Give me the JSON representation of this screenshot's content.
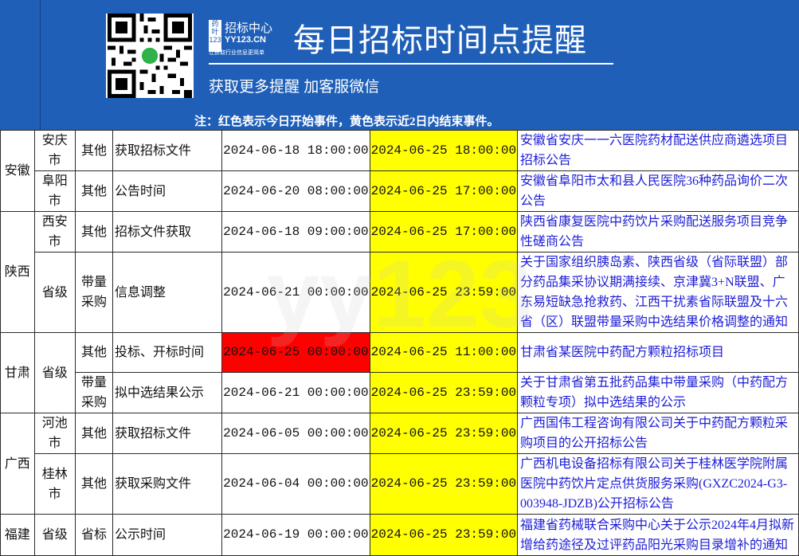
{
  "header": {
    "brand_name": "招标中心",
    "brand_domain": "YY123.CN",
    "brand_badge": "药叶123",
    "brand_slogan": "让获取行业信息更简单",
    "title": "每日招标时间点提醒",
    "subtitle": "获取更多提醒  加客服微信",
    "note": "注：红色表示今日开始事件，黄色表示近2日内结束事件。",
    "colors": {
      "header_bg": "#1f5fb8",
      "start_today": "#ff0000",
      "ending_soon": "#ffff00",
      "link": "#1d1dd6"
    }
  },
  "table": {
    "rows": [
      {
        "province": "安徽",
        "city": "安庆市",
        "type": "其他",
        "event": "获取招标文件",
        "start": "2024-06-18 18:00:00",
        "end": "2024-06-25 18:00:00",
        "project": "安徽省安庆一一六医院药材配送供应商遴选项目招标公告"
      },
      {
        "province": "安徽",
        "city": "阜阳市",
        "type": "其他",
        "event": "公告时间",
        "start": "2024-06-20 08:00:00",
        "end": "2024-06-25 17:00:00",
        "project": "安徽省阜阳市太和县人民医院36种药品询价二次公告"
      },
      {
        "province": "陕西",
        "city": "西安市",
        "type": "其他",
        "event": "招标文件获取",
        "start": "2024-06-18 09:00:00",
        "end": "2024-06-25 17:00:00",
        "project": "陕西省康复医院中药饮片采购配送服务项目竞争性磋商公告"
      },
      {
        "province": "陕西",
        "city": "省级",
        "type": "带量采购",
        "event": "信息调整",
        "start": "2024-06-21 00:00:00",
        "end": "2024-06-25 23:59:00",
        "project": "关于国家组织胰岛素、陕西省级（省际联盟）部分药品集采协议期满接续、京津冀3+N联盟、广东易短缺急抢救药、江西干扰素省际联盟及十六省（区）联盟带量采购中选结果价格调整的通知"
      },
      {
        "province": "甘肃",
        "city": "省级",
        "type": "其他",
        "event": "投标、开标时间",
        "start": "2024-06-25 00:00:00",
        "end": "2024-06-25 11:00:00",
        "project": "甘肃省某医院中药配方颗粒招标项目"
      },
      {
        "province": "甘肃",
        "city": "省级",
        "type": "带量采购",
        "event": "拟中选结果公示",
        "start": "2024-06-21 00:00:00",
        "end": "2024-06-25 23:59:00",
        "project": "关于甘肃省第五批药品集中带量采购（中药配方颗粒专项）拟中选结果的公示"
      },
      {
        "province": "广西",
        "city": "河池市",
        "type": "其他",
        "event": "获取招标文件",
        "start": "2024-06-05 00:00:00",
        "end": "2024-06-25 23:59:00",
        "project": "广西国伟工程咨询有限公司关于中药配方颗粒采购项目的公开招标公告"
      },
      {
        "province": "广西",
        "city": "桂林市",
        "type": "其他",
        "event": "获取采购文件",
        "start": "2024-06-04 00:00:00",
        "end": "2024-06-25 23:59:00",
        "project": "广西机电设备招标有限公司关于桂林医学院附属医院中药饮片定点供货服务采购(GXZC2024-G3-003948-JDZB)公开招标公告"
      },
      {
        "province": "福建",
        "city": "省级",
        "type": "省标",
        "event": "公示时间",
        "start": "2024-06-19 00:00:00",
        "end": "2024-06-25 23:59:00",
        "project": "福建省药械联合采购中心关于公示2024年4月拟新增给药途径及过评药品阳光采购目录增补的通知"
      }
    ]
  },
  "watermark": "yy123"
}
